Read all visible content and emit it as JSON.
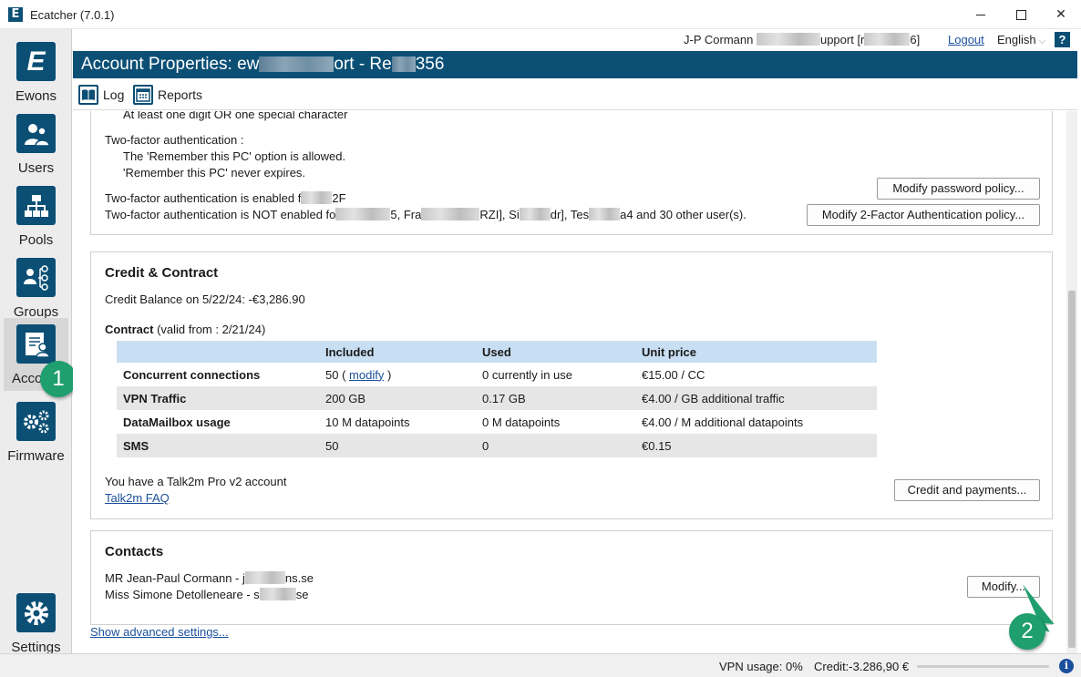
{
  "window": {
    "title": "Ecatcher (7.0.1)",
    "logo_letter": "E",
    "close_glyph": "✕"
  },
  "nav": {
    "items": [
      {
        "label": "Ewons",
        "icon": "ewon-logo-icon"
      },
      {
        "label": "Users",
        "icon": "users-icon"
      },
      {
        "label": "Pools",
        "icon": "pools-icon"
      },
      {
        "label": "Groups",
        "icon": "groups-icon"
      },
      {
        "label": "Acco",
        "icon": "account-icon"
      },
      {
        "label": "Firmware",
        "icon": "firmware-icon"
      },
      {
        "label": "Settings",
        "icon": "settings-icon"
      }
    ]
  },
  "callouts": {
    "one": "1",
    "two": "2"
  },
  "userbar": {
    "user_prefix": "J-P Cormann",
    "user_mid": "upport [r",
    "user_suffix": "6]",
    "logout": "Logout",
    "language": "English",
    "help": "?"
  },
  "header": {
    "title_a": "Account Properties: ew",
    "title_b": "ort - Re",
    "title_c": "356"
  },
  "toolbar": {
    "log": "Log",
    "reports": "Reports"
  },
  "password_section": {
    "digit_rule": "At least one digit OR one special character",
    "tfa_heading": "Two-factor authentication :",
    "tfa_line1": "The 'Remember this PC' option is allowed.",
    "tfa_line2": "'Remember this PC' never expires.",
    "enabled_a": "Two-factor authentication is enabled f",
    "enabled_b": "2F",
    "not_enabled_a": "Two-factor authentication is NOT enabled fo",
    "not_enabled_b": "5, Fra",
    "not_enabled_c": "RZI], Si",
    "not_enabled_d": "dr], Tes",
    "not_enabled_e": "a4 and 30 other user(s).",
    "modify_password_policy": "Modify password policy...",
    "modify_tfa_policy": "Modify 2-Factor Authentication policy..."
  },
  "credit_section": {
    "title": "Credit & Contract",
    "balance": "Credit Balance on 5/22/24: -€3,286.90",
    "contract_label": "Contract",
    "contract_valid": "(valid from : 2/21/24)",
    "columns": [
      "",
      "Included",
      "Used",
      "Unit price"
    ],
    "rows": [
      {
        "name": "Concurrent connections",
        "included": "50",
        "modify_open": "( ",
        "modify": "modify",
        "modify_close": " )",
        "used": "0 currently in use",
        "price": "€15.00 / CC"
      },
      {
        "name": "VPN Traffic",
        "included": "200 GB",
        "used": "0.17 GB",
        "price": "€4.00 / GB additional traffic"
      },
      {
        "name": "DataMailbox usage",
        "included": "10 M datapoints",
        "used": "0 M datapoints",
        "price": "€4.00 / M additional datapoints"
      },
      {
        "name": "SMS",
        "included": "50",
        "used": "0",
        "price": "€0.15"
      }
    ],
    "account_type": "You have a Talk2m Pro v2 account",
    "faq_link": "Talk2m FAQ",
    "credit_button": "Credit and payments..."
  },
  "contacts_section": {
    "title": "Contacts",
    "contact1_a": "MR Jean-Paul Cormann  - j",
    "contact1_b": "ns.se",
    "contact2_a": "Miss Simone Detolleneare  - s",
    "contact2_b": "se",
    "modify_button": "Modify..."
  },
  "advanced_link": "Show advanced settings...",
  "statusbar": {
    "vpn_usage": "VPN usage:  0%",
    "credit": "Credit:-3.286,90 €",
    "info": "i"
  },
  "colors": {
    "brand_blue": "#0b4f75",
    "callout_green": "#1f9e6e",
    "table_header": "#c8dff3",
    "link_blue": "#1a4f9c"
  }
}
